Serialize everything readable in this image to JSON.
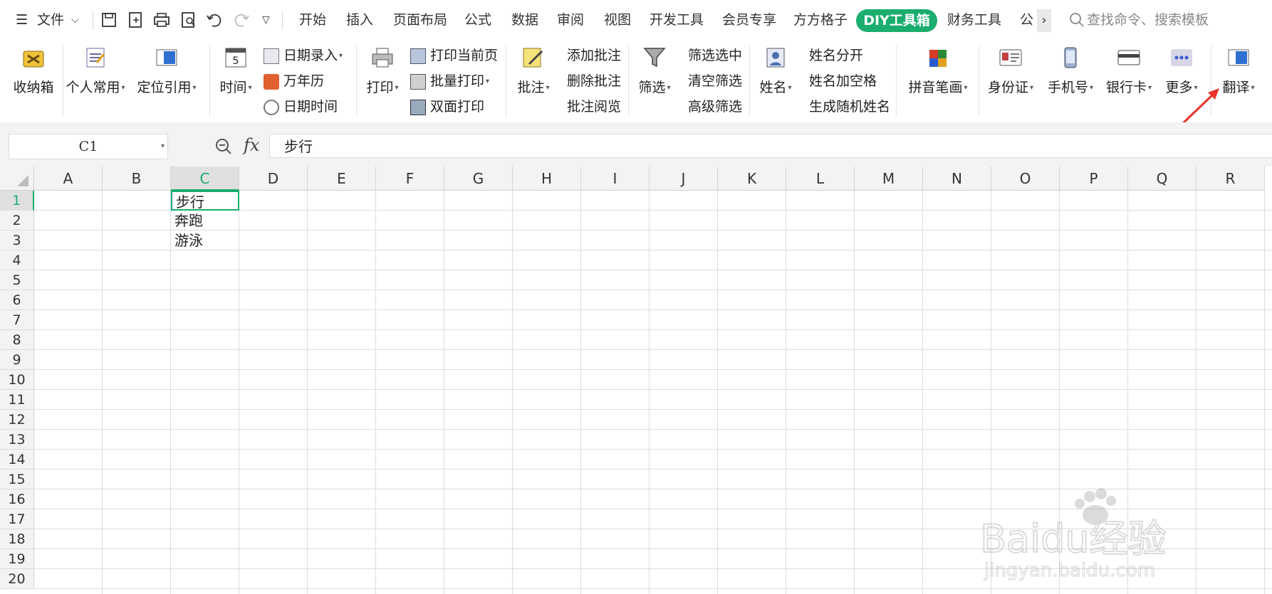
{
  "menubar": {
    "file_label": "文件",
    "tabs": [
      "开始",
      "插入",
      "页面布局",
      "公式",
      "数据",
      "审阅",
      "视图",
      "开发工具",
      "会员专享",
      "方方格子"
    ],
    "active_tab": "DIY工具箱",
    "tabs_after": [
      "财务工具",
      "公"
    ],
    "search_placeholder": "查找命令、搜索模板"
  },
  "ribbon": {
    "big_buttons": {
      "shoucangxiang": "收纳箱",
      "gerenchangyong": "个人常用",
      "dingweiyinyong": "定位引用",
      "shijian": "时间",
      "dayin": "打印",
      "pizhu": "批注",
      "shaixuan": "筛选",
      "xingming": "姓名",
      "pinyin": "拼音笔画",
      "shenfenzheng": "身份证",
      "shoujihao": "手机号",
      "yinhangka": "银行卡",
      "gengduo": "更多",
      "fanyi": "翻译"
    },
    "small_buttons": {
      "riqi_luru": "日期录入",
      "wannianli": "万年历",
      "riqi_shijian": "日期时间",
      "dayin_dangqianye": "打印当前页",
      "piliang_dayin": "批量打印",
      "shuangmian_dayin": "双面打印",
      "tianjia_pizhu": "添加批注",
      "shanchu_pizhu": "删除批注",
      "pizhu_yuelan": "批注阅览",
      "shaixuan_xuanzhong": "筛选选中",
      "qingkong_shaixuan": "清空筛选",
      "gaoji_shaixuan": "高级筛选",
      "xingming_fenkai": "姓名分开",
      "xingming_jiakongge": "姓名加空格",
      "shengcheng_suiji": "生成随机姓名"
    }
  },
  "formula_bar": {
    "name_box": "C1",
    "fx_label": "fx",
    "content": "步行"
  },
  "sheet": {
    "columns": [
      "A",
      "B",
      "C",
      "D",
      "E",
      "F",
      "G",
      "H",
      "I",
      "J",
      "K",
      "L",
      "M",
      "N",
      "O",
      "P",
      "Q",
      "R"
    ],
    "rows": [
      "1",
      "2",
      "3",
      "4",
      "5",
      "6",
      "7",
      "8",
      "9",
      "10",
      "11",
      "12",
      "13",
      "14",
      "15",
      "16",
      "17",
      "18",
      "19",
      "20"
    ],
    "cells": {
      "C1": "步行",
      "C2": "奔跑",
      "C3": "游泳"
    }
  },
  "watermark": {
    "brand": "Baidu经验",
    "url": "jingyan.baidu.com"
  },
  "colors": {
    "accent": "#1aad6e",
    "annotation_arrow": "#e8342a"
  }
}
